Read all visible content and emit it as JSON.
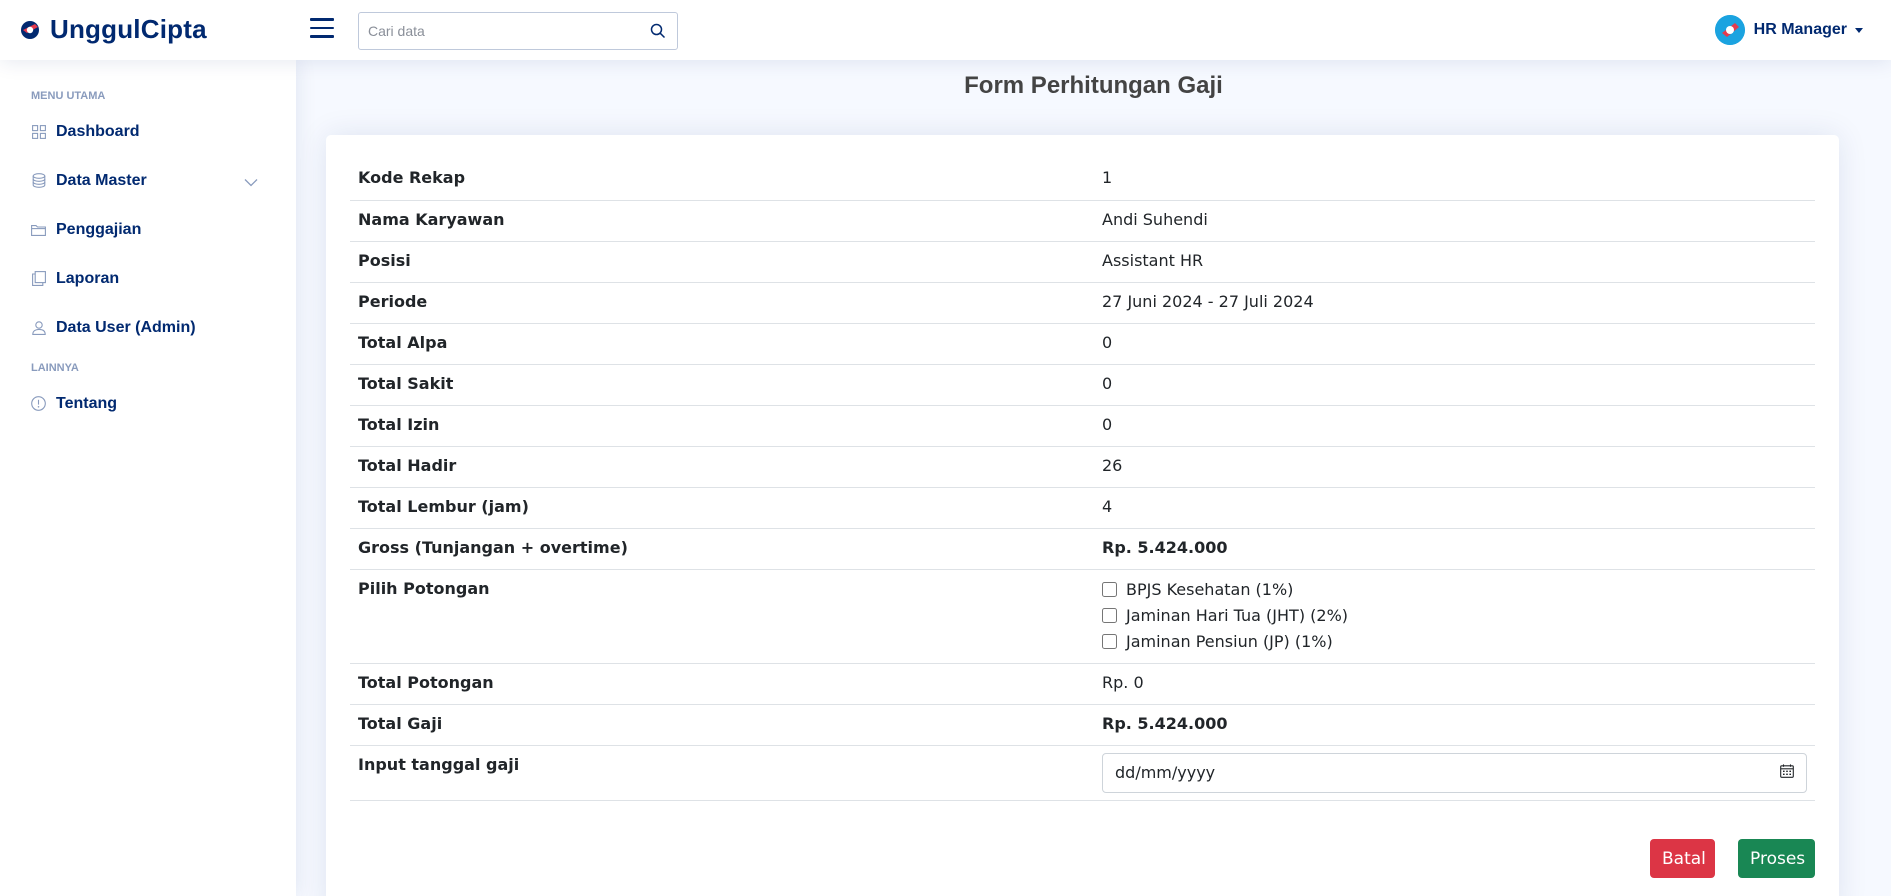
{
  "app": {
    "name": "UnggulCipta",
    "brand_color": "#012970"
  },
  "header": {
    "search_placeholder": "Cari data",
    "user_name": "HR Manager"
  },
  "sidebar": {
    "heading_main": "MENU UTAMA",
    "heading_other": "LAINNYA",
    "items": [
      {
        "label": "Dashboard",
        "icon": "grid-icon"
      },
      {
        "label": "Data Master",
        "icon": "database-icon"
      },
      {
        "label": "Penggajian",
        "icon": "folder-icon"
      },
      {
        "label": "Laporan",
        "icon": "copy-icon"
      },
      {
        "label": "Data User (Admin)",
        "icon": "user-icon"
      },
      {
        "label": "Tentang",
        "icon": "info-icon"
      }
    ]
  },
  "page": {
    "title": "Form Perhitungan Gaji"
  },
  "form": {
    "rows": [
      {
        "label": "Kode Rekap",
        "value": "1"
      },
      {
        "label": "Nama Karyawan",
        "value": "Andi Suhendi"
      },
      {
        "label": "Posisi",
        "value": "Assistant HR"
      },
      {
        "label": "Periode",
        "value": "27 Juni 2024 - 27 Juli 2024"
      },
      {
        "label": "Total Alpa",
        "value": "0"
      },
      {
        "label": "Total Sakit",
        "value": "0"
      },
      {
        "label": "Total Izin",
        "value": "0"
      },
      {
        "label": "Total Hadir",
        "value": "26"
      },
      {
        "label": "Total Lembur (jam)",
        "value": "4"
      },
      {
        "label": "Gross (Tunjangan + overtime)",
        "value": "Rp. 5.424.000"
      }
    ],
    "potongan_label": "Pilih Potongan",
    "potongan_options": [
      {
        "label": "BPJS Kesehatan (1%)",
        "checked": false
      },
      {
        "label": "Jaminan Hari Tua (JHT) (2%)",
        "checked": false
      },
      {
        "label": "Jaminan Pensiun (JP) (1%)",
        "checked": false
      }
    ],
    "total_potongan_label": "Total Potongan",
    "total_potongan_value": "Rp. 0",
    "total_gaji_label": "Total Gaji",
    "total_gaji_value": "Rp. 5.424.000",
    "tanggal_label": "Input tanggal gaji",
    "tanggal_placeholder": "dd/mm/yyyy"
  },
  "buttons": {
    "cancel": "Batal",
    "submit": "Proses"
  },
  "colors": {
    "danger": "#dc3545",
    "success": "#198754"
  }
}
